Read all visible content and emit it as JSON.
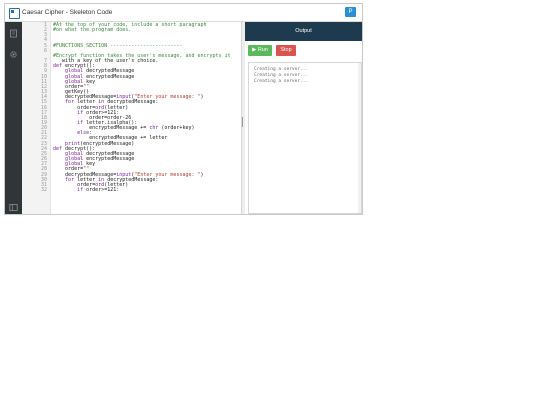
{
  "window": {
    "title": "Caesar Cipher - Skeleton Code",
    "action_label": "P"
  },
  "sidebar": {
    "icons": [
      "document-icon",
      "gear-icon",
      "panel-icon"
    ]
  },
  "editor": {
    "line_numbers": [
      "1",
      "2",
      "3",
      "4",
      "5",
      "6",
      "",
      "7",
      "8",
      "9",
      "10",
      "11",
      "12",
      "13",
      "14",
      "15",
      "16",
      "17",
      "18",
      "19",
      "20",
      "21",
      "22",
      "23",
      "24",
      "25",
      "26",
      "27",
      "28",
      "29",
      "30",
      "31",
      "32"
    ],
    "lines": [
      "#At the top of your code, include a short paragraph",
      "#on what the program does.",
      "",
      "",
      "#FUNCTIONS SECTION ------------------------",
      "",
      "#Encrypt function takes the user's message, and encrypts it",
      "   with a key of the user's choice.",
      "def encrypt():",
      "    global decryptedMessage",
      "    global encryptedMessage",
      "    global key",
      "    order=\"\"",
      "    getKey()",
      "    decryptedMessage=input(\"Enter your message: \")",
      "    for letter in decryptedMessage:",
      "        order=ord(letter)",
      "        if order>=121:",
      "            order=order-26",
      "        if letter.isalpha():",
      "            encryptedMessage += chr (order+key)",
      "        else:",
      "            encryptedMessage += letter",
      "    print(encryptedMessage)",
      "def decrypt():",
      "    global decryptedMessage",
      "    global encryptedMessage",
      "    global key",
      "    order=\"\"",
      "    decryptedMessage=input(\"Enter your message: \")",
      "    for letter in decryptedMessage:",
      "        order=ord(letter)",
      "        if order>=121:"
    ]
  },
  "output": {
    "header": "Output",
    "run_label": "Run",
    "stop_label": "Stop",
    "console_lines": [
      "Creating a server...",
      "Creating a server...",
      "Creating a server..."
    ]
  }
}
